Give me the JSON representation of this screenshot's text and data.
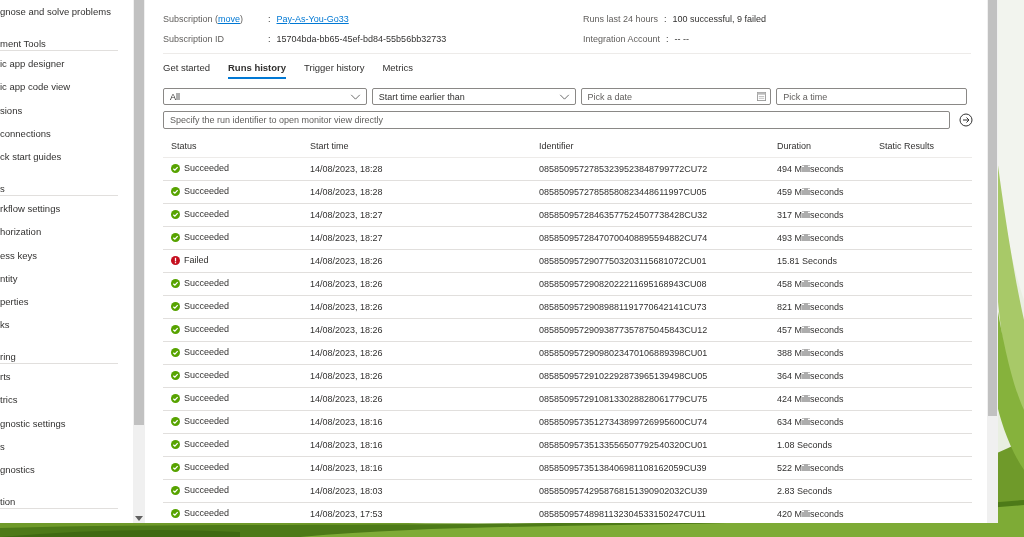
{
  "sidebar": {
    "sections": [
      {
        "items": [
          "gnose and solve problems"
        ]
      },
      {
        "heading": "ment Tools",
        "items": [
          "ic app designer",
          "ic app code view",
          "sions",
          "connections",
          "ck start guides"
        ]
      },
      {
        "heading": "s",
        "items": [
          "rkflow settings",
          "horization",
          "ess keys",
          "ntity",
          "perties",
          "ks"
        ]
      },
      {
        "heading": "ring",
        "items": [
          "rts",
          "trics",
          "gnostic settings",
          "s",
          "gnostics"
        ]
      },
      {
        "heading": "tion"
      }
    ]
  },
  "essentials": [
    {
      "label": "Subscription (",
      "link": "move",
      "label_end": ")",
      "separator": ":",
      "value": "Pay-As-You-Go33",
      "kind": "link"
    },
    {
      "label": "Runs last 24 hours",
      "separator": ":",
      "value": "100 successful, 9 failed",
      "kind": "text"
    },
    {
      "label": "Subscription ID",
      "separator": ":",
      "value": "15704bda-bb65-45ef-bd84-55b56bb32733",
      "kind": "text"
    },
    {
      "label": "Integration Account",
      "separator": ":",
      "value": "-- --",
      "kind": "text"
    }
  ],
  "tabs": [
    {
      "label": "Get started",
      "selected": false
    },
    {
      "label": "Runs history",
      "selected": true
    },
    {
      "label": "Trigger history",
      "selected": false
    },
    {
      "label": "Metrics",
      "selected": false
    }
  ],
  "filters": {
    "status": "All",
    "time_filter": "Start time earlier than",
    "date_placeholder": "Pick a date",
    "time_placeholder": "Pick a time",
    "run_id_placeholder": "Specify the run identifier to open monitor view directly"
  },
  "table": {
    "columns": [
      "Status",
      "Start time",
      "Identifier",
      "Duration",
      "Static Results"
    ],
    "rows": [
      {
        "kind": "succeeded",
        "status": "Succeeded",
        "start": "14/08/2023, 18:28",
        "id": "08585095727853239523848799772CU72",
        "duration": "494 Milliseconds"
      },
      {
        "kind": "succeeded",
        "status": "Succeeded",
        "start": "14/08/2023, 18:28",
        "id": "08585095727858580823448611997CU05",
        "duration": "459 Milliseconds"
      },
      {
        "kind": "succeeded",
        "status": "Succeeded",
        "start": "14/08/2023, 18:27",
        "id": "08585095728463577524507738428CU32",
        "duration": "317 Milliseconds"
      },
      {
        "kind": "succeeded",
        "status": "Succeeded",
        "start": "14/08/2023, 18:27",
        "id": "08585095728470700408895594882CU74",
        "duration": "493 Milliseconds"
      },
      {
        "kind": "failed",
        "status": "Failed",
        "start": "14/08/2023, 18:26",
        "id": "08585095729077503203115681072CU01",
        "duration": "15.81 Seconds"
      },
      {
        "kind": "succeeded",
        "status": "Succeeded",
        "start": "14/08/2023, 18:26",
        "id": "08585095729082022211695168943CU08",
        "duration": "458 Milliseconds"
      },
      {
        "kind": "succeeded",
        "status": "Succeeded",
        "start": "14/08/2023, 18:26",
        "id": "08585095729089881191770642141CU73",
        "duration": "821 Milliseconds"
      },
      {
        "kind": "succeeded",
        "status": "Succeeded",
        "start": "14/08/2023, 18:26",
        "id": "08585095729093877357875045843CU12",
        "duration": "457 Milliseconds"
      },
      {
        "kind": "succeeded",
        "status": "Succeeded",
        "start": "14/08/2023, 18:26",
        "id": "08585095729098023470106889398CU01",
        "duration": "388 Milliseconds"
      },
      {
        "kind": "succeeded",
        "status": "Succeeded",
        "start": "14/08/2023, 18:26",
        "id": "08585095729102292873965139498CU05",
        "duration": "364 Milliseconds"
      },
      {
        "kind": "succeeded",
        "status": "Succeeded",
        "start": "14/08/2023, 18:26",
        "id": "08585095729108133028828061779CU75",
        "duration": "424 Milliseconds"
      },
      {
        "kind": "succeeded",
        "status": "Succeeded",
        "start": "14/08/2023, 18:16",
        "id": "08585095735127343899726995600CU74",
        "duration": "634 Milliseconds"
      },
      {
        "kind": "succeeded",
        "status": "Succeeded",
        "start": "14/08/2023, 18:16",
        "id": "08585095735133556507792540320CU01",
        "duration": "1.08 Seconds"
      },
      {
        "kind": "succeeded",
        "status": "Succeeded",
        "start": "14/08/2023, 18:16",
        "id": "08585095735138406981108162059CU39",
        "duration": "522 Milliseconds"
      },
      {
        "kind": "succeeded",
        "status": "Succeeded",
        "start": "14/08/2023, 18:03",
        "id": "08585095742958768151390902032CU39",
        "duration": "2.83 Seconds"
      },
      {
        "kind": "succeeded",
        "status": "Succeeded",
        "start": "14/08/2023, 17:53",
        "id": "08585095748981132304533150247CU11",
        "duration": "420 Milliseconds"
      }
    ]
  }
}
